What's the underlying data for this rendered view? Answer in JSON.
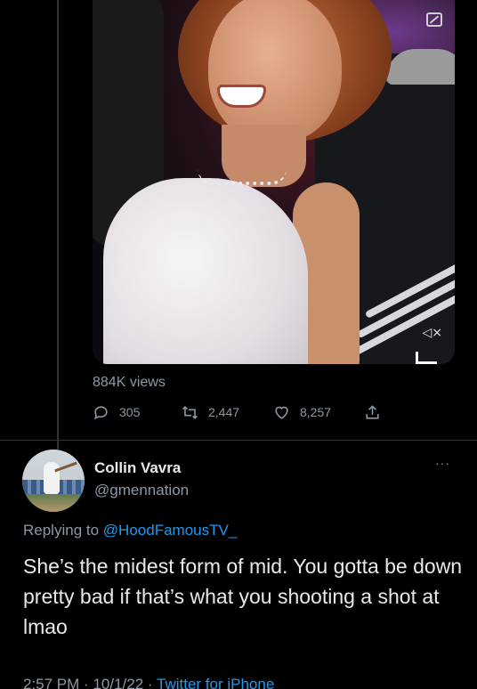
{
  "media": {
    "views": "884K views",
    "icons": [
      "expand-icon",
      "mute-icon",
      "tiktok-icon"
    ]
  },
  "actions": {
    "replies": "305",
    "retweets": "2,447",
    "likes": "8,257"
  },
  "reply": {
    "name": "Collin Vavra",
    "handle": "@gmennation",
    "replying_prefix": "Replying to",
    "replying_to": "@HoodFamousTV_",
    "text": "She’s the midest form of mid. You gotta be down pretty bad if that’s what you shooting a shot at lmao",
    "time": "2:57 PM",
    "date": "10/1/22",
    "sep": "·",
    "source": "Twitter for iPhone",
    "more": "···"
  },
  "colors": {
    "background": "#000000",
    "text": "#e7e9ea",
    "secondary": "#8b98a5",
    "accent": "#1d9bf0",
    "divider": "#2f3336"
  }
}
